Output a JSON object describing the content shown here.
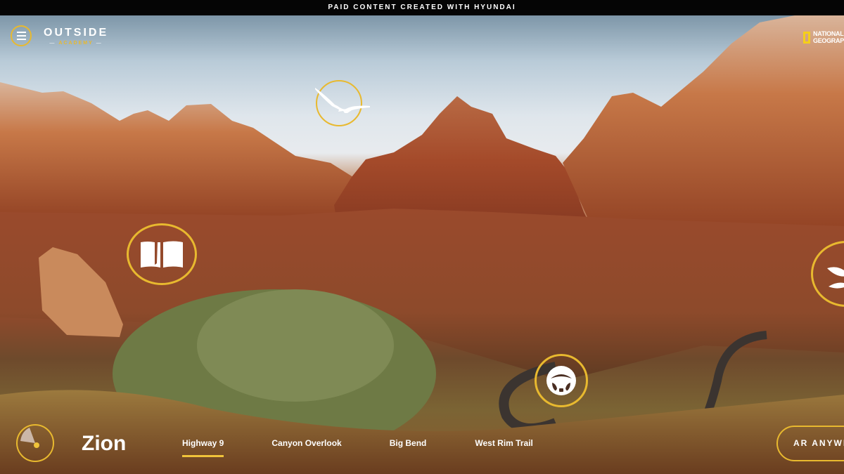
{
  "banner": {
    "text": "PAID CONTENT CREATED WITH HYUNDAI"
  },
  "brand": {
    "name": "OUTSIDE",
    "sub": "ACADEMY"
  },
  "partner": {
    "line1": "NATIONAL",
    "line2": "GEOGRAPHIC"
  },
  "hotspots": [
    {
      "icon": "bird-icon",
      "label": "wildlife"
    },
    {
      "icon": "book-icon",
      "label": "story"
    },
    {
      "icon": "steering-wheel-icon",
      "label": "drive"
    },
    {
      "icon": "leaf-icon",
      "label": "plants"
    }
  ],
  "location": {
    "name": "Zion"
  },
  "tabs": [
    {
      "label": "Highway 9",
      "active": true
    },
    {
      "label": "Canyon Overlook",
      "active": false
    },
    {
      "label": "Big Bend",
      "active": false
    },
    {
      "label": "West Rim Trail",
      "active": false
    }
  ],
  "cta": {
    "label": "AR ANYWHERE"
  },
  "colors": {
    "accent": "#e8b92f",
    "banner_bg": "#050505",
    "text": "#ffffff"
  }
}
